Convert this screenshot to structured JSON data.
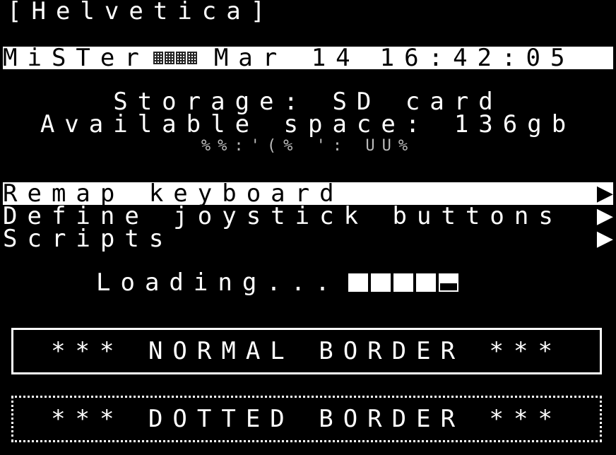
{
  "font_title": "[Helvetica]",
  "status_bar": {
    "device": "MiSTer",
    "date": "Mar 14",
    "time": "16:42:05",
    "icons": [
      "network-icon",
      "grid-icon",
      "grid-icon",
      "keyboard-icon"
    ]
  },
  "storage": {
    "line1": "Storage: SD card",
    "line2": "Available space: 136gb",
    "line3": "%%:'(% ': UU%"
  },
  "menu": {
    "items": [
      {
        "label": "Remap keyboard",
        "selected": true
      },
      {
        "label": "Define joystick buttons",
        "selected": false
      },
      {
        "label": "Scripts",
        "selected": false
      }
    ],
    "arrow_glyph": "▶"
  },
  "loading": {
    "label": "Loading...",
    "progress_cells": 5,
    "progress_value": 0.9
  },
  "boxes": {
    "normal_label": "*** NORMAL BORDER ***",
    "dotted_label": "*** DOTTED BORDER ***"
  },
  "colors": {
    "background": "#000000",
    "foreground": "#ffffff"
  }
}
